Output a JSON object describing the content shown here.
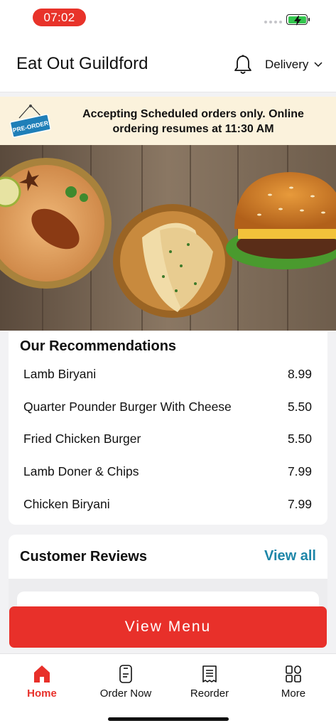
{
  "status_bar": {
    "time": "07:02"
  },
  "header": {
    "title": "Eat Out Guildford",
    "mode_label": "Delivery"
  },
  "banner": {
    "tag": "PRE-ORDER",
    "message": "Accepting Scheduled orders only. Online ordering resumes at 11:30 AM"
  },
  "recommendations": {
    "title": "Our Recommendations",
    "items": [
      {
        "name": "Lamb Biryani",
        "price": "8.99"
      },
      {
        "name": "Quarter Pounder Burger With Cheese",
        "price": "5.50"
      },
      {
        "name": "Fried Chicken Burger",
        "price": "5.50"
      },
      {
        "name": "Lamb Doner & Chips",
        "price": "7.99"
      },
      {
        "name": "Chicken Biryani",
        "price": "7.99"
      }
    ]
  },
  "reviews": {
    "title": "Customer Reviews",
    "view_all": "View all"
  },
  "cta": {
    "label": "View Menu"
  },
  "tabs": [
    {
      "label": "Home",
      "icon": "home-icon",
      "active": true
    },
    {
      "label": "Order Now",
      "icon": "order-icon",
      "active": false
    },
    {
      "label": "Reorder",
      "icon": "receipt-icon",
      "active": false
    },
    {
      "label": "More",
      "icon": "grid-icon",
      "active": false
    }
  ],
  "colors": {
    "accent": "#e8302a",
    "link": "#1d86a8",
    "banner_bg": "#fbf2dc",
    "battery": "#33c64e"
  }
}
